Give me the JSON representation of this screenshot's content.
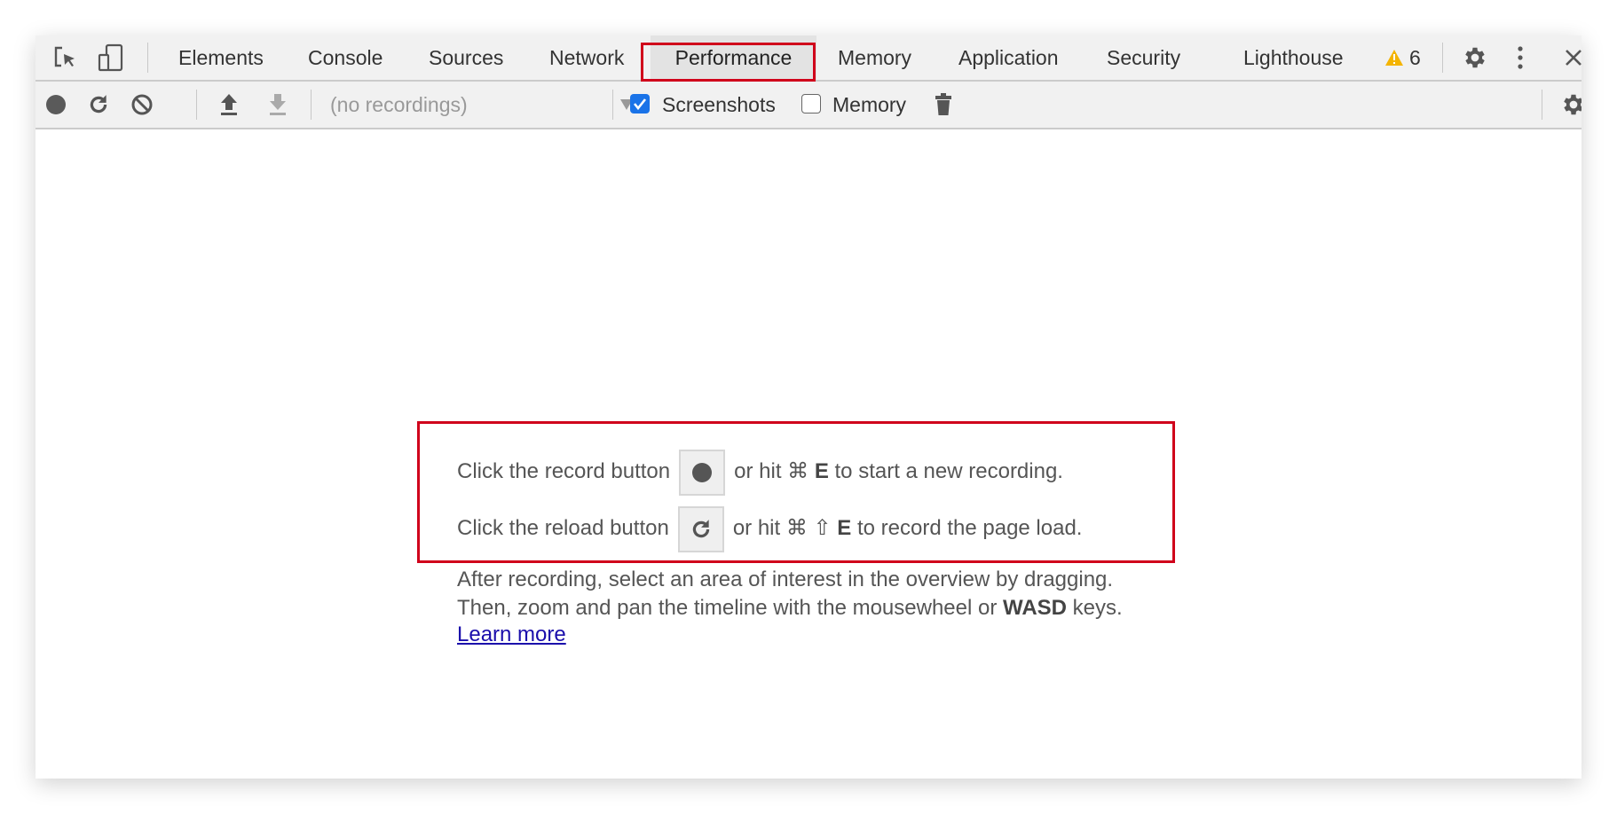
{
  "tabs": [
    {
      "label": "Elements"
    },
    {
      "label": "Console"
    },
    {
      "label": "Sources"
    },
    {
      "label": "Network"
    },
    {
      "label": "Performance",
      "active": true
    },
    {
      "label": "Memory"
    },
    {
      "label": "Application"
    },
    {
      "label": "Security"
    },
    {
      "label": "Lighthouse"
    }
  ],
  "warnings": {
    "count": "6",
    "icon": "warning-icon",
    "color": "#f4b400"
  },
  "toolbar": {
    "recordings_select": "(no recordings)",
    "screenshots_label": "Screenshots",
    "screenshots_checked": true,
    "memory_label": "Memory",
    "memory_checked": false
  },
  "landing": {
    "record_prefix": "Click the record button",
    "record_suffix_a": "or hit ⌘ ",
    "record_key": "E",
    "record_suffix_b": " to start a new recording.",
    "reload_prefix": "Click the reload button",
    "reload_suffix_a": "or hit ⌘ ⇧ ",
    "reload_key": "E",
    "reload_suffix_b": " to record the page load.",
    "after_line1": "After recording, select an area of interest in the overview by dragging.",
    "after_line2a": "Then, zoom and pan the timeline with the mousewheel or ",
    "after_line2_bold": "WASD",
    "after_line2b": " keys.",
    "learn_more": "Learn more"
  },
  "colors": {
    "highlight": "#d0021b",
    "checkbox": "#1a73e8",
    "link": "#1a0dab"
  }
}
